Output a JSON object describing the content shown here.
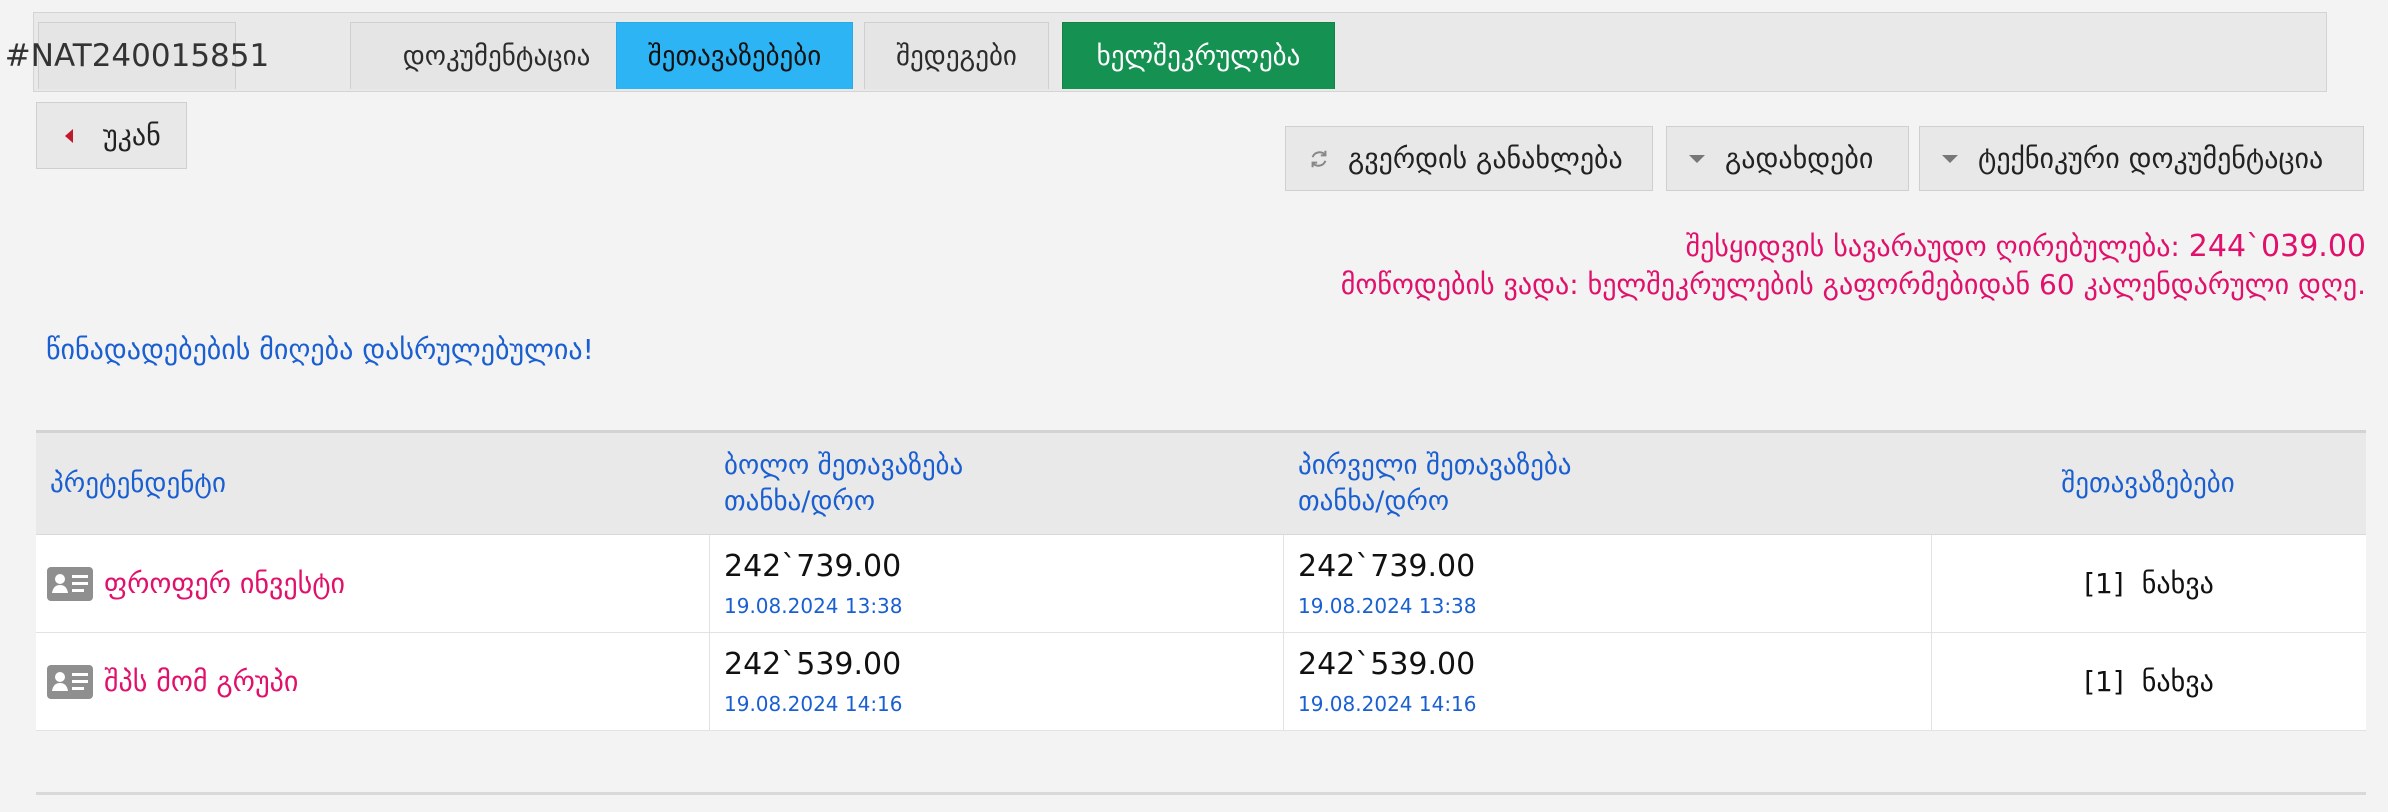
{
  "tabs": [
    {
      "label": "#NAT240015851"
    },
    {
      "label": "დოკუმენტაცია"
    },
    {
      "label": "შეთავაზებები"
    },
    {
      "label": "შედეგები"
    },
    {
      "label": "ხელშეკრულება"
    }
  ],
  "toolbar": {
    "back_label": "უკან",
    "refresh_label": "გვერდის განახლება",
    "payments_label": "გადახდები",
    "tech_docs_label": "ტექნიკური დოკუმენტაცია"
  },
  "price_info": {
    "estimated_label": "შესყიდვის სავარაუდო ღირებულება:",
    "estimated_value": "244`039.00",
    "delivery_text": "მოწოდების ვადა: ხელშეკრულების გაფორმებიდან 60 კალენდარული დღე."
  },
  "status_message": "წინადადებების მიღება დასრულებულია!",
  "table": {
    "headers": {
      "bidders": "პრეტენდენტი",
      "last_offer_line1": "ბოლო შეთავაზება",
      "last_offer_line2": "თანხა/დრო",
      "first_offer_line1": "პირველი შეთავაზება",
      "first_offer_line2": "თანხა/დრო",
      "offers": "შეთავაზებები"
    },
    "rows": [
      {
        "company": "ფროფერ ინვესტი",
        "last_amount": "242`739.00",
        "last_time": "19.08.2024 13:38",
        "first_amount": "242`739.00",
        "first_time": "19.08.2024 13:38",
        "offers_count": "[1]",
        "view_label": "ნახვა"
      },
      {
        "company": "შპს მომ გრუპი",
        "last_amount": "242`539.00",
        "last_time": "19.08.2024 14:16",
        "first_amount": "242`539.00",
        "first_time": "19.08.2024 14:16",
        "offers_count": "[1]",
        "view_label": "ნახვა"
      }
    ]
  },
  "colors": {
    "active_tab": "#2db4f5",
    "contract_tab": "#159152",
    "accent_pink": "#e0106b",
    "accent_blue": "#1a5fd1"
  },
  "icons": {
    "back": "caret-left-icon",
    "refresh": "refresh-icon",
    "dropdown": "caret-down-icon",
    "company": "id-card-icon"
  }
}
